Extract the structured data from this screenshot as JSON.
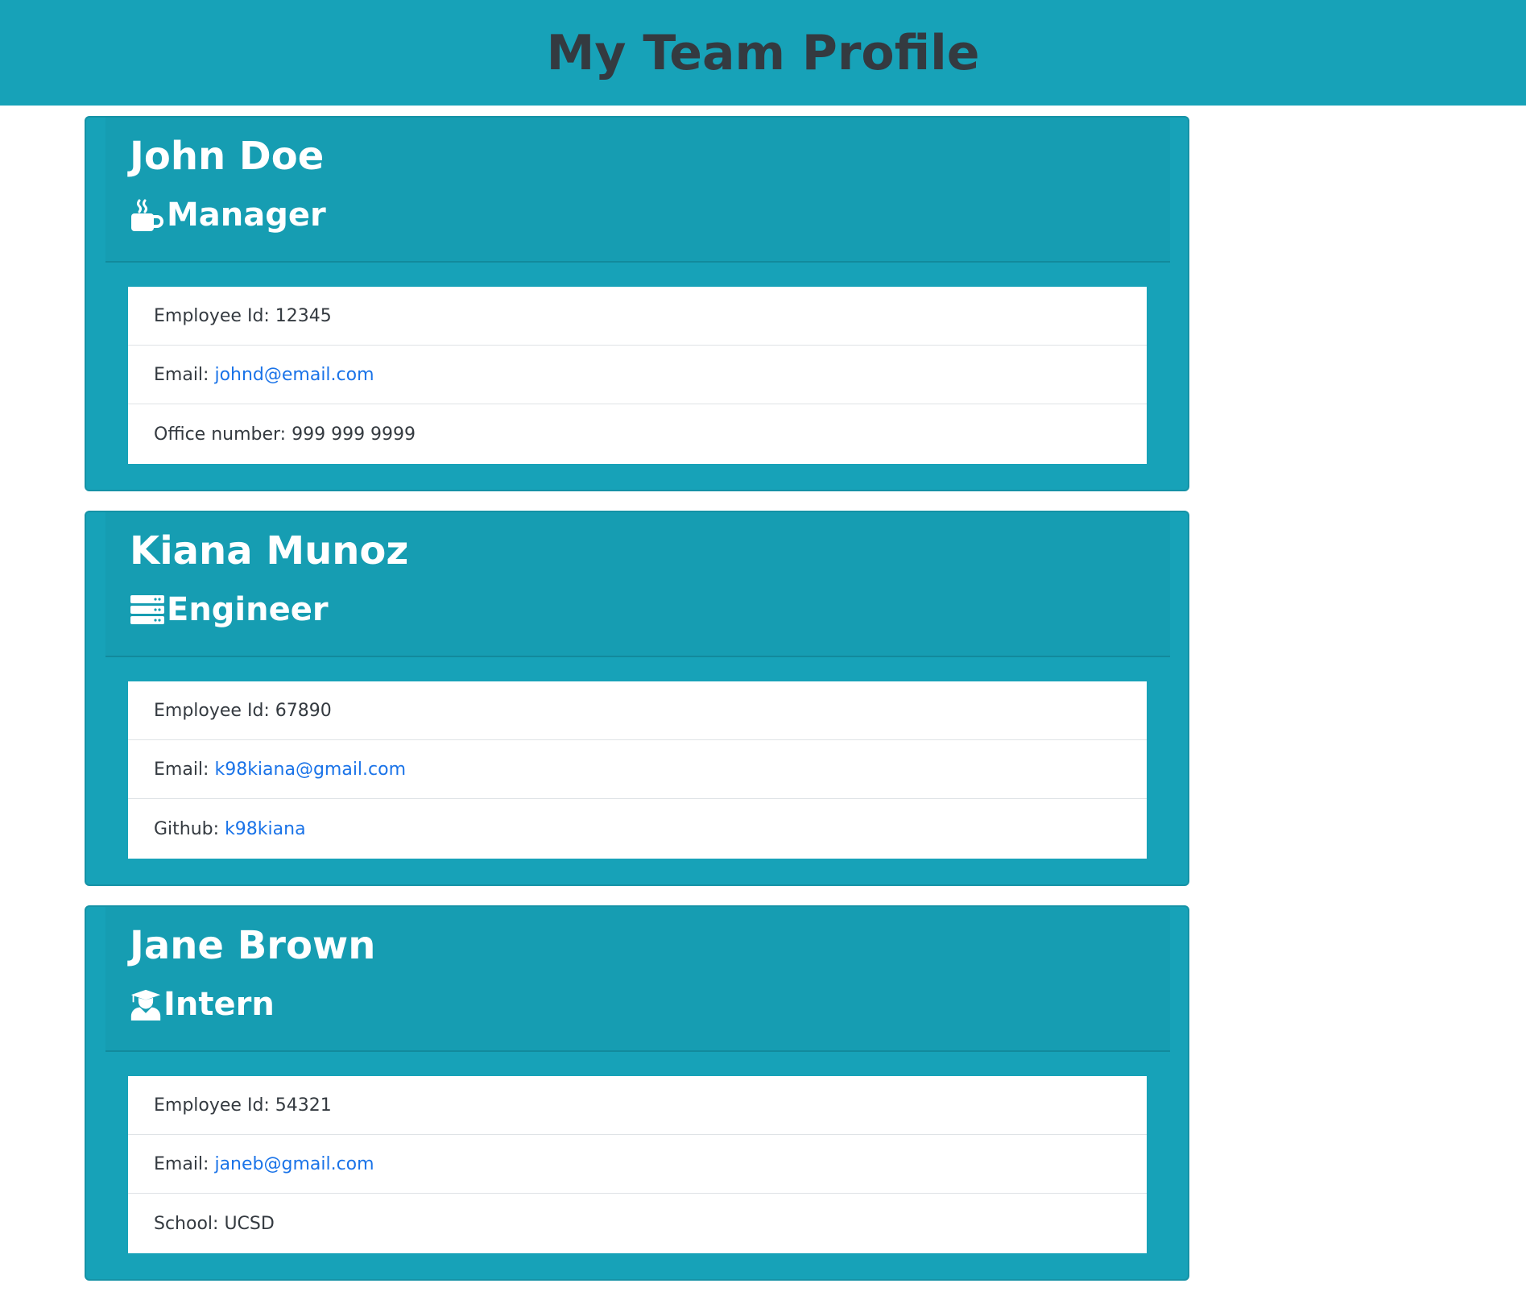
{
  "header": {
    "title": "My Team Profile"
  },
  "colors": {
    "header_bg": "#17a2b8",
    "card_bg": "#17a2b8",
    "title_text": "#343a40",
    "card_text": "#ffffff",
    "link": "#1a73e8"
  },
  "employees": [
    {
      "name": "John Doe",
      "role": "Manager",
      "role_icon": "mug-hot-icon",
      "id_label": "Employee Id: 12345",
      "email_label": "Email:",
      "email": "johnd@email.com",
      "extra_label": "Office number: 999 999 9999",
      "extra_link": ""
    },
    {
      "name": "Kiana Munoz",
      "role": "Engineer",
      "role_icon": "server-icon",
      "id_label": "Employee Id: 67890",
      "email_label": "Email:",
      "email": "k98kiana@gmail.com",
      "extra_label": "Github:",
      "extra_link": "k98kiana"
    },
    {
      "name": "Jane Brown",
      "role": "Intern",
      "role_icon": "user-graduate-icon",
      "id_label": "Employee Id: 54321",
      "email_label": "Email:",
      "email": "janeb@gmail.com",
      "extra_label": "School: UCSD",
      "extra_link": ""
    }
  ]
}
